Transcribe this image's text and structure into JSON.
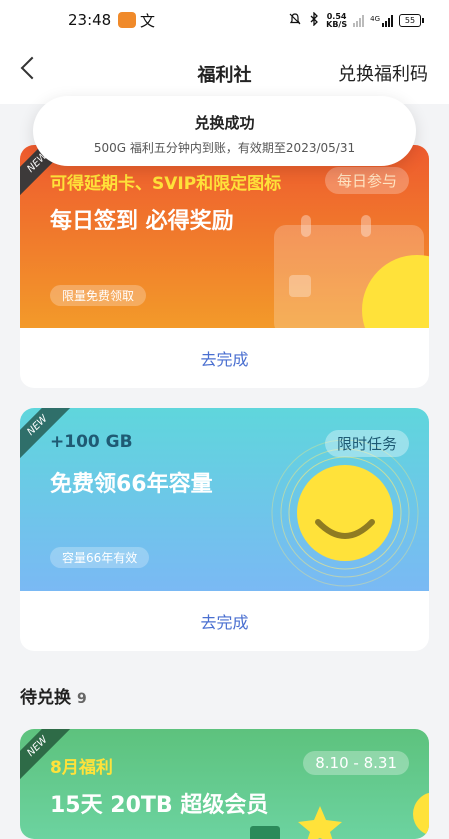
{
  "status_bar": {
    "time": "23:48",
    "app_icon_2": "文",
    "net_speed_value": "0.54",
    "net_speed_unit": "KB/S",
    "network_type": "4G",
    "battery": "55"
  },
  "nav": {
    "title": "福利社",
    "right_action": "兑换福利码"
  },
  "toast": {
    "title": "兑换成功",
    "message": "500G 福利五分钟内到账，有效期至2023/05/31"
  },
  "cards": [
    {
      "badge": "NEW",
      "subtitle": "可得延期卡、SVIP和限定图标",
      "tag": "每日参与",
      "title": "每日签到 必得奖励",
      "pill": "限量免费领取",
      "action": "去完成"
    },
    {
      "badge": "NEW",
      "subtitle": "+100 GB",
      "tag": "限时任务",
      "title": "免费领66年容量",
      "pill": "容量66年有效",
      "action": "去完成"
    }
  ],
  "pending": {
    "label": "待兑换",
    "count": "9"
  },
  "pending_card": {
    "badge": "NEW",
    "subtitle": "8月福利",
    "tag": "8.10 - 8.31",
    "title": "15天 20TB 超级会员"
  },
  "colors": {
    "accent_link": "#4a6fd0",
    "card1_gradient": [
      "#ee5a2e",
      "#f7a726"
    ],
    "card2_gradient": [
      "#5fd6dc",
      "#7ab9f4"
    ],
    "card3_gradient": [
      "#5dc27d",
      "#6cd3a0"
    ]
  }
}
